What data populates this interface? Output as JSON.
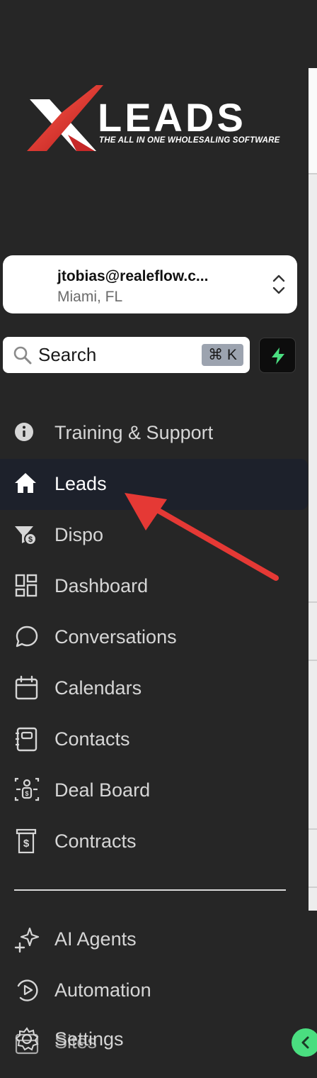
{
  "brand": {
    "word": "LEADS",
    "tagline": "THE ALL IN ONE WHOLESALING SOFTWARE",
    "accent_red": "#e53935"
  },
  "account": {
    "email": "jtobias@realeflow.c...",
    "location": "Miami, FL"
  },
  "search": {
    "label": "Search",
    "shortcut": "⌘ K"
  },
  "nav": {
    "items": [
      {
        "label": "Training & Support",
        "icon": "info-icon"
      },
      {
        "label": "Leads",
        "icon": "home-icon",
        "active": true
      },
      {
        "label": "Dispo",
        "icon": "dispo-filter-dollar-icon"
      },
      {
        "label": "Dashboard",
        "icon": "dashboard-grid-icon"
      },
      {
        "label": "Conversations",
        "icon": "chat-bubble-icon"
      },
      {
        "label": "Calendars",
        "icon": "calendar-icon"
      },
      {
        "label": "Contacts",
        "icon": "contacts-book-icon"
      },
      {
        "label": "Deal Board",
        "icon": "deal-board-icon"
      },
      {
        "label": "Contracts",
        "icon": "contract-dollar-icon"
      }
    ],
    "secondary": [
      {
        "label": "AI Agents",
        "icon": "sparkle-icon"
      },
      {
        "label": "Automation",
        "icon": "automation-icon"
      },
      {
        "label": "Settings",
        "icon": "gear-icon"
      },
      {
        "label": "Sites",
        "icon": "sites-icon"
      }
    ]
  },
  "colors": {
    "sidebar_bg": "#262626",
    "active_bg": "#1d212b",
    "bolt_green": "#4ade80",
    "arrow_red": "#e53935"
  }
}
